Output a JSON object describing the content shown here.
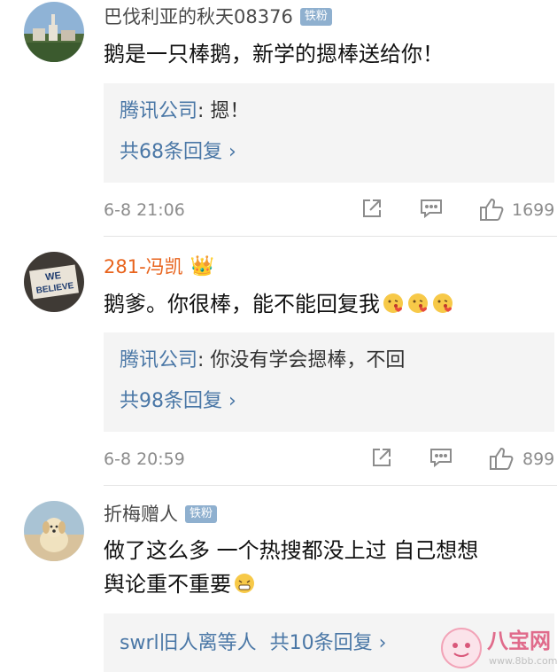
{
  "comments": [
    {
      "username": "巴伐利亚的秋天08376",
      "badge": "铁粉",
      "text": "鹅是一只棒鹅，新学的摁棒送给你！",
      "reply": {
        "author": "腾讯公司",
        "sep": ": ",
        "text": "摁！"
      },
      "more_replies": "共68条回复 ›",
      "time": "6-8 21:06",
      "likes": "1699"
    },
    {
      "username": "281-冯凯",
      "crown": "👑",
      "text": "鹅爹。你很棒，能不能回复我",
      "reply": {
        "author": "腾讯公司",
        "sep": ": ",
        "text": "你没有学会摁棒，不回"
      },
      "more_replies": "共98条回复 ›",
      "time": "6-8 20:59",
      "likes": "899",
      "avatar_text": [
        "WE",
        "BELIEVE"
      ]
    },
    {
      "username": "折梅赠人",
      "badge": "铁粉",
      "text_line1": "做了这么多 一个热搜都没上过 自己想想",
      "text_line2": "舆论重不重要",
      "last_reply": {
        "author": "swrl旧人离等人",
        "count": "共10条回复 ›"
      }
    }
  ],
  "watermark": {
    "name": "八宝网",
    "url": "www.8bb.com"
  },
  "colors": {
    "link": "#4a77a6",
    "username_vip": "#e8631c",
    "badge": "#8fb0cf",
    "meta": "#8c8c8c"
  }
}
